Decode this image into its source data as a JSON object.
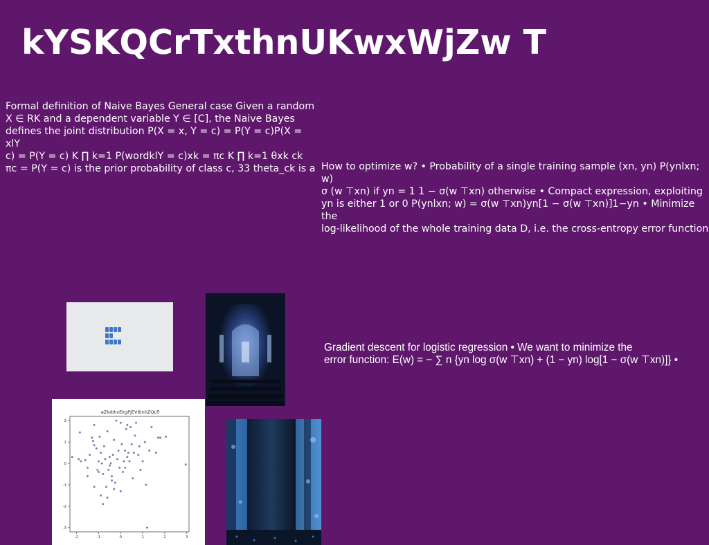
{
  "slide": {
    "title": "kYSKQCrTxthnUKwxWjZw T",
    "text_block_1": "Formal definition of Naive Bayes General case Given a random\nX ∈ RK and a dependent variable Y ∈ [C], the Naive Bayes\ndefines the joint distribution P(X = x, Y = c) = P(Y = c)P(X = xlY\nc) = P(Y = c) K ∏ k=1 P(wordklY = c)xk = πc K ∏ k=1 θxk ck\nπc = P(Y = c) is the prior probability of class c, 33 theta_ck is a",
    "text_block_2": "How to optimize w? • Probability of a single training sample (xn, yn) P(ynlxn; w)\nσ (w ⊤xn) if yn = 1 1 − σ(w ⊤xn) otherwise • Compact expression, exploiting\nyn is either 1 or 0 P(ynlxn; w) = σ(w ⊤xn)yn[1 − σ(w ⊤xn)]1−yn • Minimize the\nlog-likelihood of the whole training data D, i.e. the cross-entropy error function",
    "text_block_3": "Gradient descent for logistic regression • We want to minimize the\nerror function: E(w) = − ∑ n {yn log σ(w ⊤xn) + (1 − yn) log[1 − σ(w ⊤xn)]} •"
  },
  "colors": {
    "background": "#5e176b",
    "text": "#ffffff",
    "scatter_point": "#7b5aa6"
  },
  "images": [
    {
      "name": "keycaps-photo"
    },
    {
      "name": "church-interior-photo"
    },
    {
      "name": "scatter-plot-figure"
    },
    {
      "name": "tree-trunk-photo"
    }
  ],
  "chart_data": {
    "type": "scatter",
    "title": "eZlobhvEkgPjEVltinhZQLfl",
    "xlabel": "",
    "ylabel": "",
    "xlim": [
      -2.3,
      3.1
    ],
    "ylim": [
      -3.2,
      2.2
    ],
    "xticks": [
      "-2",
      "-1",
      "0",
      "1",
      "2",
      "3"
    ],
    "yticks": [
      "2",
      "1",
      "0",
      "-1",
      "-2",
      "-3"
    ],
    "xtick_values": [
      -2,
      -1,
      0,
      1,
      2,
      3
    ],
    "ytick_values": [
      2,
      1,
      0,
      -1,
      -2,
      -3
    ],
    "points": [
      [
        -2.2,
        0.3
      ],
      [
        -1.9,
        0.2
      ],
      [
        -1.8,
        0.1
      ],
      [
        -1.85,
        1.45
      ],
      [
        -1.6,
        0.15
      ],
      [
        -1.5,
        -0.2
      ],
      [
        -1.5,
        -0.6
      ],
      [
        -1.4,
        0.4
      ],
      [
        -1.3,
        1.2
      ],
      [
        -1.25,
        1.05
      ],
      [
        -1.2,
        0.85
      ],
      [
        -1.2,
        1.8
      ],
      [
        -1.1,
        0.7
      ],
      [
        -1.05,
        -0.3
      ],
      [
        -1.0,
        0.1
      ],
      [
        -1.0,
        -0.4
      ],
      [
        -0.95,
        1.25
      ],
      [
        -0.9,
        0.5
      ],
      [
        -0.85,
        0.0
      ],
      [
        -0.8,
        -0.5
      ],
      [
        -0.75,
        0.8
      ],
      [
        -0.7,
        0.2
      ],
      [
        -0.65,
        -1.1
      ],
      [
        -0.6,
        1.5
      ],
      [
        -0.55,
        -0.3
      ],
      [
        -0.5,
        0.3
      ],
      [
        -0.45,
        0.0
      ],
      [
        -0.4,
        -0.6
      ],
      [
        -0.4,
        -0.8
      ],
      [
        -0.35,
        0.4
      ],
      [
        -0.3,
        1.1
      ],
      [
        -0.25,
        -0.9
      ],
      [
        -0.2,
        2.0
      ],
      [
        -0.15,
        0.2
      ],
      [
        -0.1,
        0.6
      ],
      [
        -0.05,
        -0.2
      ],
      [
        0.0,
        1.9
      ],
      [
        0.05,
        0.9
      ],
      [
        0.1,
        -0.4
      ],
      [
        0.15,
        0.1
      ],
      [
        0.2,
        0.6
      ],
      [
        0.25,
        1.6
      ],
      [
        0.3,
        0.3
      ],
      [
        0.3,
        1.8
      ],
      [
        0.35,
        0.5
      ],
      [
        0.4,
        0.1
      ],
      [
        0.45,
        1.7
      ],
      [
        0.5,
        0.9
      ],
      [
        0.55,
        -0.7
      ],
      [
        0.6,
        0.5
      ],
      [
        0.65,
        1.3
      ],
      [
        0.7,
        1.9
      ],
      [
        0.8,
        0.4
      ],
      [
        0.85,
        0.8
      ],
      [
        0.9,
        -0.3
      ],
      [
        1.0,
        0.1
      ],
      [
        1.1,
        1.0
      ],
      [
        1.15,
        -1.0
      ],
      [
        1.2,
        -3.0
      ],
      [
        1.3,
        0.6
      ],
      [
        1.4,
        1.7
      ],
      [
        1.6,
        0.5
      ],
      [
        1.7,
        1.2
      ],
      [
        1.8,
        1.2
      ],
      [
        2.05,
        1.25
      ],
      [
        2.95,
        -0.05
      ],
      [
        -0.9,
        -1.5
      ],
      [
        -0.6,
        -1.6
      ],
      [
        -1.2,
        -1.1
      ],
      [
        0.0,
        -1.3
      ],
      [
        -0.3,
        -1.2
      ],
      [
        -0.8,
        -1.9
      ],
      [
        -0.5,
        -0.1
      ],
      [
        0.2,
        -0.2
      ]
    ]
  }
}
